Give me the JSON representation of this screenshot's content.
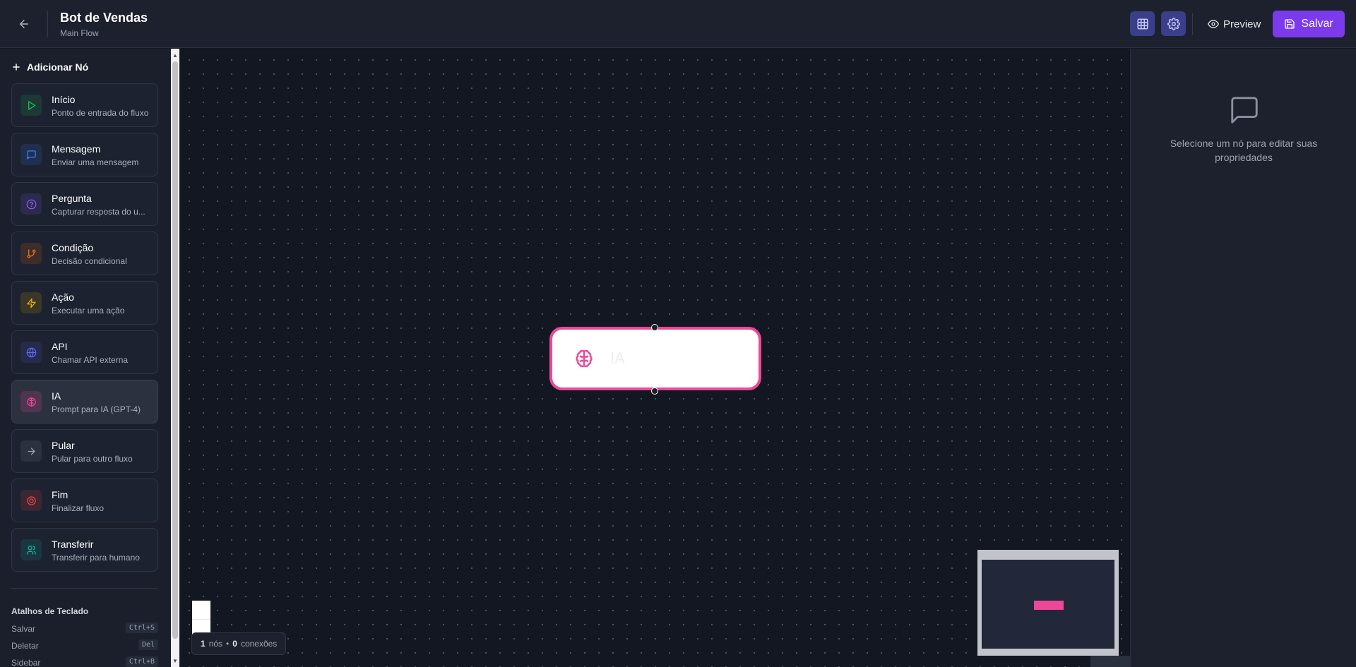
{
  "header": {
    "bot_name": "Bot de Vendas",
    "flow_name": "Main Flow",
    "preview_label": "Preview",
    "save_label": "Salvar",
    "accent_color": "#7c3aed"
  },
  "sidebar": {
    "title": "Adicionar Nó",
    "nodes": [
      {
        "label": "Início",
        "desc": "Ponto de entrada do fluxo",
        "icon": "play-icon",
        "color": "#22c55e"
      },
      {
        "label": "Mensagem",
        "desc": "Enviar uma mensagem",
        "icon": "message-icon",
        "color": "#3b82f6"
      },
      {
        "label": "Pergunta",
        "desc": "Capturar resposta do u...",
        "icon": "help-circle-icon",
        "color": "#8b5cf6"
      },
      {
        "label": "Condição",
        "desc": "Decisão condicional",
        "icon": "git-branch-icon",
        "color": "#f97316"
      },
      {
        "label": "Ação",
        "desc": "Executar uma ação",
        "icon": "zap-icon",
        "color": "#eab308"
      },
      {
        "label": "API",
        "desc": "Chamar API externa",
        "icon": "globe-icon",
        "color": "#6366f1"
      },
      {
        "label": "IA",
        "desc": "Prompt para IA (GPT-4)",
        "icon": "brain-icon",
        "color": "#ec4899"
      },
      {
        "label": "Pular",
        "desc": "Pular para outro fluxo",
        "icon": "arrow-right-icon",
        "color": "#9ca3af"
      },
      {
        "label": "Fim",
        "desc": "Finalizar fluxo",
        "icon": "stop-circle-icon",
        "color": "#ef4444"
      },
      {
        "label": "Transferir",
        "desc": "Transferir para humano",
        "icon": "users-icon",
        "color": "#14b8a6"
      }
    ],
    "shortcuts_title": "Atalhos de Teclado",
    "shortcuts": [
      {
        "label": "Salvar",
        "key": "Ctrl+S"
      },
      {
        "label": "Deletar",
        "key": "Del"
      },
      {
        "label": "Sidebar",
        "key": "Ctrl+B"
      }
    ]
  },
  "canvas": {
    "node_label": "IA",
    "node_color": "#ec4899",
    "stats": {
      "nodes": "1",
      "nodes_label": "nós",
      "sep": "•",
      "connections": "0",
      "connections_label": "conexões"
    }
  },
  "right_panel": {
    "empty_text": "Selecione um nó para editar suas propriedades"
  }
}
